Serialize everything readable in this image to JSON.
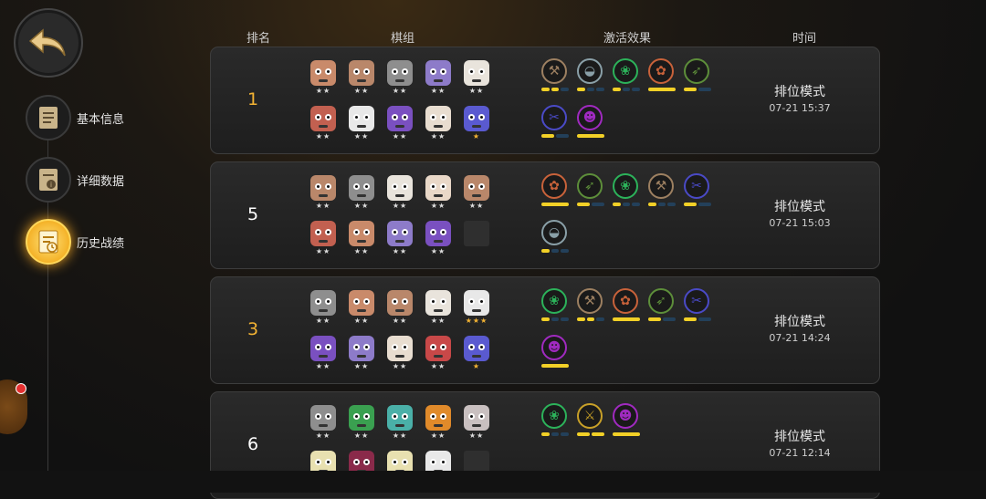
{
  "nav": {
    "items": [
      {
        "label": "基本信息"
      },
      {
        "label": "详细数据"
      },
      {
        "label": "历史战绩"
      }
    ]
  },
  "headers": {
    "rank": "排名",
    "lineup": "棋组",
    "effects": "激活效果",
    "time": "时间"
  },
  "colors": {
    "accent": "#f2b233",
    "bar_on": "#f2d027",
    "bar_off": "#23405a"
  },
  "matches": [
    {
      "rank": "1",
      "gold": true,
      "mode": "排位模式",
      "time": "07-21 15:37",
      "pieces": [
        {
          "c": "#c98a6a",
          "s": "★★"
        },
        {
          "c": "#b9876a",
          "s": "★★"
        },
        {
          "c": "#8e8e8e",
          "s": "★★"
        },
        {
          "c": "#8d7bc9",
          "s": "★★"
        },
        {
          "c": "#e9e4dc",
          "s": "★★"
        },
        {
          "c": "#c26050",
          "s": "★★"
        },
        {
          "c": "#e8e8e8",
          "s": "★★"
        },
        {
          "c": "#7a50c0",
          "s": "★★"
        },
        {
          "c": "#e8ddd0",
          "s": "★★"
        },
        {
          "c": "#5a5ad0",
          "s": "★",
          "gold": true
        }
      ],
      "traits": [
        {
          "name": "axe-icon",
          "c": "#9d8061",
          "g": "⚒",
          "bars": [
            1,
            1,
            0
          ]
        },
        {
          "name": "cap-icon",
          "c": "#8aa0a8",
          "g": "◒",
          "bars": [
            1,
            0,
            0
          ]
        },
        {
          "name": "paw-icon",
          "c": "#2cb25a",
          "g": "❀",
          "bars": [
            1,
            0,
            0
          ]
        },
        {
          "name": "fox-icon",
          "c": "#c8623a",
          "g": "✿",
          "bars": [
            2
          ]
        },
        {
          "name": "bow-icon",
          "c": "#5d8e3a",
          "g": "➶",
          "bars": [
            1,
            0
          ]
        },
        {
          "name": "fishbone-icon",
          "c": "#4a4ac6",
          "g": "✂",
          "bars": [
            1,
            0
          ]
        },
        {
          "name": "demon-icon",
          "c": "#a02ac0",
          "g": "☻",
          "bars": [
            2
          ]
        }
      ]
    },
    {
      "rank": "5",
      "gold": false,
      "mode": "排位模式",
      "time": "07-21 15:03",
      "pieces": [
        {
          "c": "#b9876a",
          "s": "★★"
        },
        {
          "c": "#8e8e8e",
          "s": "★★"
        },
        {
          "c": "#e9e4dc",
          "s": "★★"
        },
        {
          "c": "#e9d8c8",
          "s": "★★"
        },
        {
          "c": "#b9876a",
          "s": "★★"
        },
        {
          "c": "#c26050",
          "s": "★★"
        },
        {
          "c": "#c98a6a",
          "s": "★★"
        },
        {
          "c": "#8d7bc9",
          "s": "★★"
        },
        {
          "c": "#7a50c0",
          "s": "★★"
        },
        {
          "empty": true
        }
      ],
      "traits": [
        {
          "name": "fox-icon",
          "c": "#c8623a",
          "g": "✿",
          "bars": [
            2
          ]
        },
        {
          "name": "bow-icon",
          "c": "#5d8e3a",
          "g": "➶",
          "bars": [
            1,
            0
          ]
        },
        {
          "name": "paw-icon",
          "c": "#2cb25a",
          "g": "❀",
          "bars": [
            1,
            0,
            0
          ]
        },
        {
          "name": "axe-icon",
          "c": "#9d8061",
          "g": "⚒",
          "bars": [
            1,
            0,
            0
          ]
        },
        {
          "name": "fishbone-icon",
          "c": "#4a4ac6",
          "g": "✂",
          "bars": [
            1,
            0
          ]
        },
        {
          "name": "cap-icon",
          "c": "#8aa0a8",
          "g": "◒",
          "bars": [
            1,
            0,
            0
          ]
        }
      ]
    },
    {
      "rank": "3",
      "gold": true,
      "mode": "排位模式",
      "time": "07-21 14:24",
      "pieces": [
        {
          "c": "#8e8e8e",
          "s": "★★"
        },
        {
          "c": "#c98a6a",
          "s": "★★"
        },
        {
          "c": "#b9876a",
          "s": "★★"
        },
        {
          "c": "#e9e4dc",
          "s": "★★"
        },
        {
          "c": "#e8e8e8",
          "s": "★★★",
          "gold": true
        },
        {
          "c": "#7a50c0",
          "s": "★★"
        },
        {
          "c": "#8d7bc9",
          "s": "★★"
        },
        {
          "c": "#e8ddd0",
          "s": "★★"
        },
        {
          "c": "#c84848",
          "s": "★★"
        },
        {
          "c": "#5a5ad0",
          "s": "★",
          "gold": true
        }
      ],
      "traits": [
        {
          "name": "paw-icon",
          "c": "#2cb25a",
          "g": "❀",
          "bars": [
            1,
            0,
            0
          ]
        },
        {
          "name": "axe-icon",
          "c": "#9d8061",
          "g": "⚒",
          "bars": [
            1,
            1,
            0
          ]
        },
        {
          "name": "fox-icon",
          "c": "#c8623a",
          "g": "✿",
          "bars": [
            2
          ]
        },
        {
          "name": "bow-icon",
          "c": "#5d8e3a",
          "g": "➶",
          "bars": [
            1,
            0
          ]
        },
        {
          "name": "fishbone-icon",
          "c": "#4a4ac6",
          "g": "✂",
          "bars": [
            1,
            0
          ]
        },
        {
          "name": "demon-icon",
          "c": "#a02ac0",
          "g": "☻",
          "bars": [
            2
          ]
        }
      ]
    },
    {
      "rank": "6",
      "gold": false,
      "mode": "排位模式",
      "time": "07-21 12:14",
      "pieces": [
        {
          "c": "#8e8e8e",
          "s": "★★"
        },
        {
          "c": "#3aa050",
          "s": "★★"
        },
        {
          "c": "#4ab0a8",
          "s": "★★"
        },
        {
          "c": "#e08a2a",
          "s": "★★"
        },
        {
          "c": "#c9c0c0",
          "s": "★★"
        },
        {
          "c": "#e8e0b0",
          "s": ""
        },
        {
          "c": "#8a2a4a",
          "s": ""
        },
        {
          "c": "#e8e0b0",
          "s": ""
        },
        {
          "c": "#e8e8e8",
          "s": ""
        },
        {
          "empty": true
        }
      ],
      "traits": [
        {
          "name": "paw-icon",
          "c": "#2cb25a",
          "g": "❀",
          "bars": [
            1,
            0,
            0
          ]
        },
        {
          "name": "sword-icon",
          "c": "#c8a028",
          "g": "⚔",
          "bars": [
            1,
            1
          ]
        },
        {
          "name": "demon-icon",
          "c": "#a02ac0",
          "g": "☻",
          "bars": [
            2
          ]
        }
      ]
    }
  ]
}
